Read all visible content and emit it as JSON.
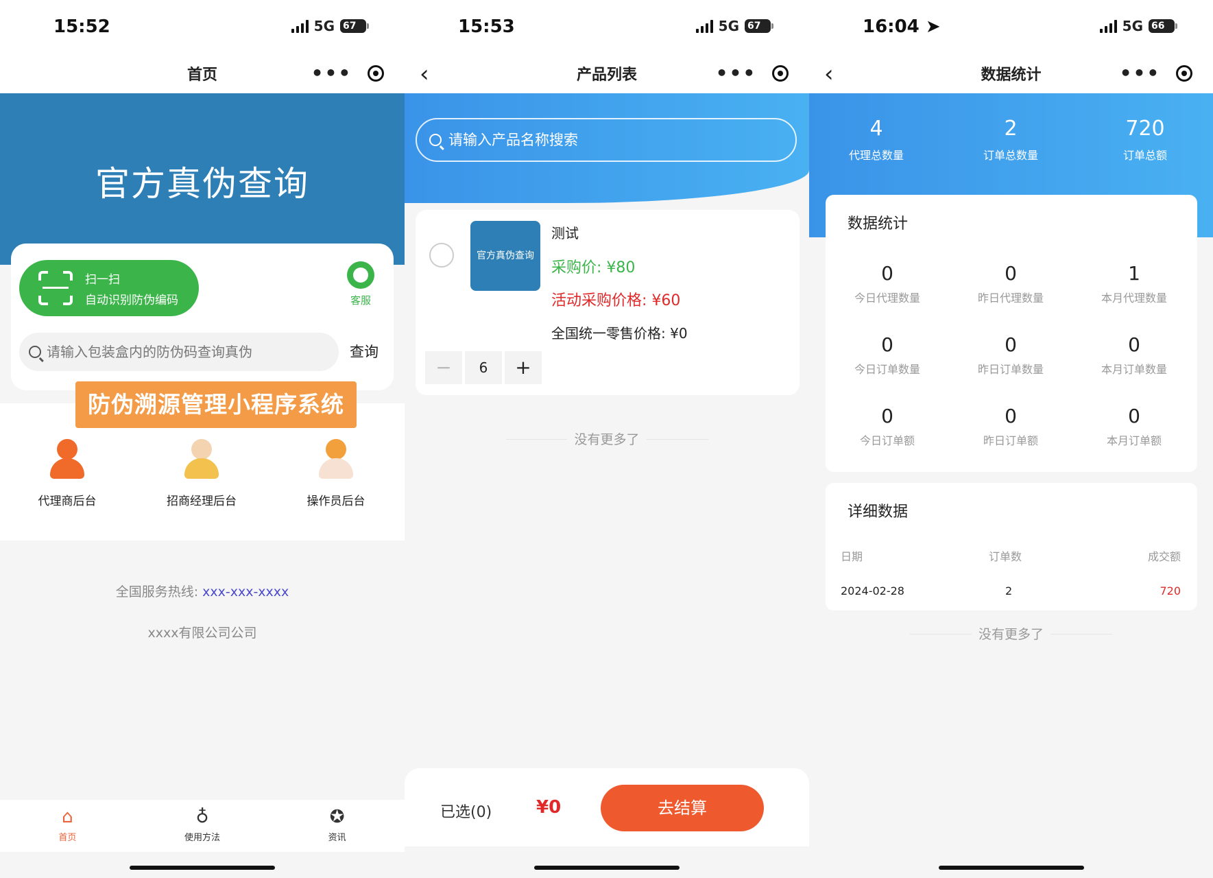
{
  "screens": {
    "home": {
      "status": {
        "time": "15:52",
        "network": "5G",
        "battery": "67"
      },
      "nav_title": "首页",
      "hero_title": "官方真伪查询",
      "scan": {
        "title": "扫一扫",
        "subtitle": "自动识别防伪编码"
      },
      "customer_service": "客服",
      "search": {
        "placeholder": "请输入包装盒内的防伪码查询真伪",
        "button": "查询"
      },
      "banner": "防伪溯源管理小程序系统",
      "roles": [
        {
          "label": "代理商后台",
          "icon": "agent-avatar-icon",
          "color": "#f06a2a"
        },
        {
          "label": "招商经理后台",
          "icon": "manager-avatar-icon",
          "color": "#f2c14e"
        },
        {
          "label": "操作员后台",
          "icon": "operator-avatar-icon",
          "color": "#f2a03c"
        }
      ],
      "hotline_label": "全国服务热线:",
      "hotline_number": "xxx-xxx-xxxx",
      "company": "xxxx有限公司公司",
      "tabs": [
        {
          "label": "首页",
          "icon": "home-icon",
          "active": true
        },
        {
          "label": "使用方法",
          "icon": "bulb-icon",
          "active": false
        },
        {
          "label": "资讯",
          "icon": "news-icon",
          "active": false
        }
      ]
    },
    "products": {
      "status": {
        "time": "15:53",
        "network": "5G",
        "battery": "67"
      },
      "nav_title": "产品列表",
      "search_placeholder": "请输入产品名称搜索",
      "product": {
        "thumb_text": "官方真伪查询",
        "name": "测试",
        "purchase_price": "采购价: ¥80",
        "activity_price": "活动采购价格: ¥60",
        "retail_price": "全国统一零售价格: ¥0",
        "quantity": "6"
      },
      "no_more": "没有更多了",
      "selected": "已选(0)",
      "total": "¥0",
      "checkout": "去结算"
    },
    "stats": {
      "status": {
        "time": "16:04",
        "network": "5G",
        "battery": "66"
      },
      "nav_title": "数据统计",
      "summary": [
        {
          "value": "4",
          "label": "代理总数量"
        },
        {
          "value": "2",
          "label": "订单总数量"
        },
        {
          "value": "720",
          "label": "订单总额"
        }
      ],
      "stats_title": "数据统计",
      "stats": [
        {
          "value": "0",
          "label": "今日代理数量"
        },
        {
          "value": "0",
          "label": "昨日代理数量"
        },
        {
          "value": "1",
          "label": "本月代理数量"
        },
        {
          "value": "0",
          "label": "今日订单数量"
        },
        {
          "value": "0",
          "label": "昨日订单数量"
        },
        {
          "value": "0",
          "label": "本月订单数量"
        },
        {
          "value": "0",
          "label": "今日订单额"
        },
        {
          "value": "0",
          "label": "昨日订单额"
        },
        {
          "value": "0",
          "label": "本月订单额"
        }
      ],
      "detail_title": "详细数据",
      "table": {
        "headers": [
          "日期",
          "订单数",
          "成交额"
        ],
        "rows": [
          [
            "2024-02-28",
            "2",
            "720"
          ]
        ]
      },
      "no_more": "没有更多了"
    }
  },
  "colors": {
    "accent_orange": "#ee5a2e",
    "green": "#3bb54a",
    "blue": "#3a93e8",
    "red": "#e02a2a"
  }
}
